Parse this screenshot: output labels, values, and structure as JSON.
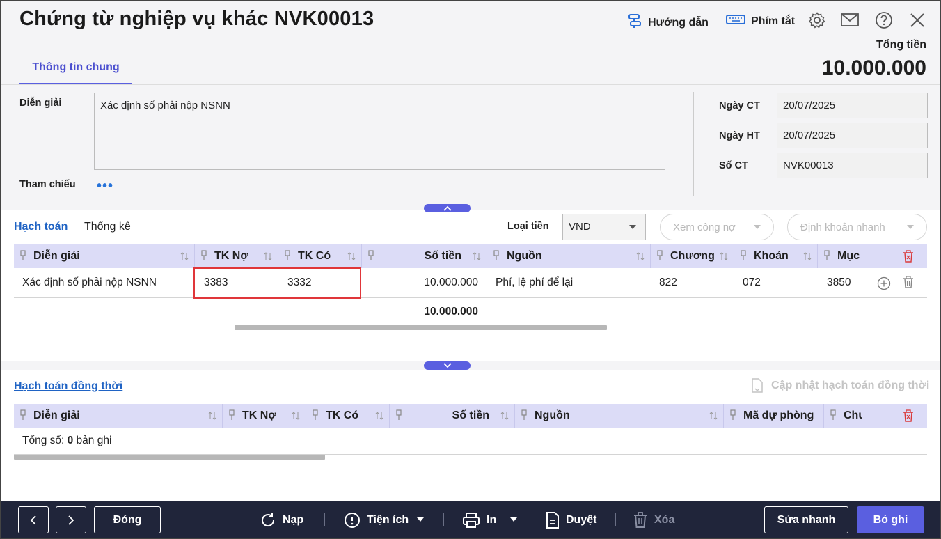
{
  "header": {
    "title": "Chứng từ nghiệp vụ khác NVK00013",
    "guide_label": "Hướng dẫn",
    "shortcut_label": "Phím tắt",
    "total_label": "Tổng tiền",
    "total_value": "10.000.000"
  },
  "tabs": {
    "general": "Thông tin chung"
  },
  "info": {
    "description_label": "Diễn giải",
    "description_value": "Xác định số phải nộp NSNN",
    "reference_label": "Tham chiếu",
    "reference_more": "•••",
    "doc_date_label": "Ngày CT",
    "doc_date": "20/07/2025",
    "post_date_label": "Ngày HT",
    "post_date": "20/07/2025",
    "doc_no_label": "Số CT",
    "doc_no": "NVK00013"
  },
  "accounting": {
    "tab_accounting": "Hạch toán",
    "tab_stats": "Thống kê",
    "currency_label": "Loại tiền",
    "currency_value": "VND",
    "view_debt_btn": "Xem công nợ",
    "quick_entry_btn": "Định khoản nhanh",
    "columns": [
      "Diễn giải",
      "TK Nợ",
      "TK Có",
      "Số tiền",
      "Nguồn",
      "Chương",
      "Khoản",
      "Mục"
    ],
    "rows": [
      {
        "desc": "Xác định số phải nộp NSNN",
        "debit": "3383",
        "credit": "3332",
        "amount": "10.000.000",
        "source": "Phí, lệ phí để lại",
        "chapter": "822",
        "section": "072",
        "item": "3850"
      }
    ],
    "total_amount": "10.000.000"
  },
  "concurrent": {
    "tab_label": "Hạch toán đồng thời",
    "update_btn": "Cập nhật hạch toán đồng thời",
    "columns": [
      "Diễn giải",
      "TK Nợ",
      "TK Có",
      "Số tiền",
      "Nguồn",
      "Mã dự phòng",
      "Chư"
    ],
    "summary_prefix": "Tổng số: ",
    "summary_count": "0",
    "summary_suffix": " bản ghi"
  },
  "footer": {
    "close_label": "Đóng",
    "reload_label": "Nạp",
    "utility_label": "Tiện ích",
    "print_label": "In",
    "approve_label": "Duyệt",
    "delete_label": "Xóa",
    "quick_edit_label": "Sửa nhanh",
    "unpost_label": "Bỏ ghi"
  },
  "colors": {
    "accent": "#5a5fe0",
    "header_bg": "#dcdcf7",
    "footer_bg": "#20253a",
    "highlight": "#e0363a"
  }
}
